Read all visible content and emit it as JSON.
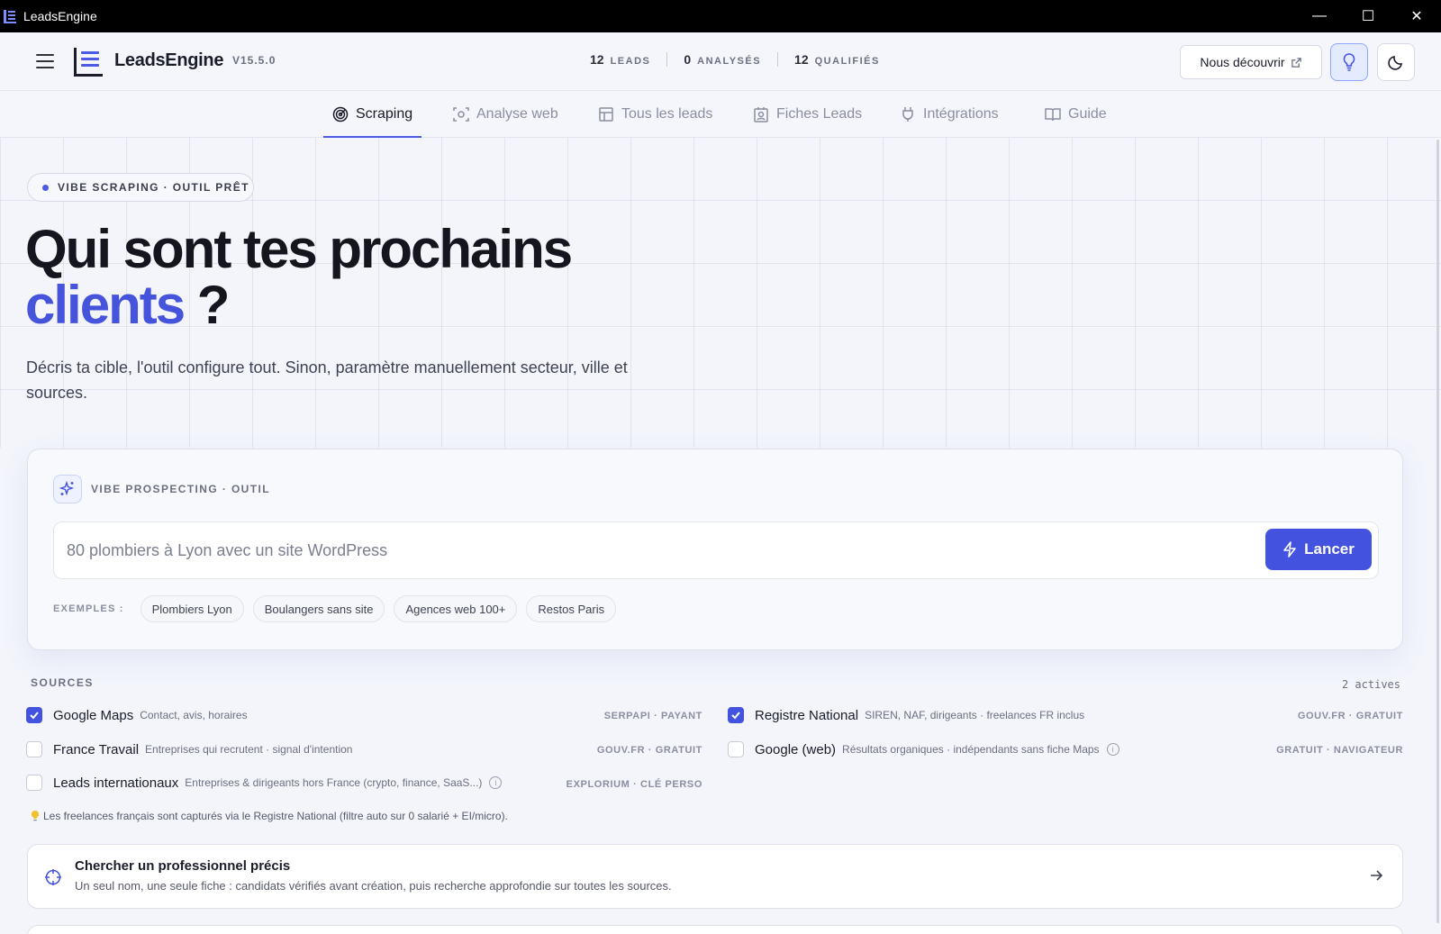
{
  "window": {
    "title": "LeadsEngine",
    "controls": {
      "minimize": "—",
      "maximize": "☐",
      "close": "✕"
    }
  },
  "header": {
    "brand": "LeadsEngine",
    "version": "V15.5.0",
    "stats": [
      {
        "num": "12",
        "label": "LEADS"
      },
      {
        "num": "0",
        "label": "ANALYSÉS"
      },
      {
        "num": "12",
        "label": "QUALIFIÉS"
      }
    ],
    "discover_label": "Nous découvrir"
  },
  "tabs": [
    {
      "label": "Scraping",
      "icon": "radar-icon",
      "active": true
    },
    {
      "label": "Analyse web",
      "icon": "scan-icon"
    },
    {
      "label": "Tous les leads",
      "icon": "table-icon"
    },
    {
      "label": "Fiches Leads",
      "icon": "contact-card-icon"
    },
    {
      "label": "Intégrations",
      "icon": "plug-icon"
    },
    {
      "label": "Guide",
      "icon": "book-icon"
    }
  ],
  "hero": {
    "status": "VIBE SCRAPING · OUTIL PRÊT",
    "title_line1": "Qui sont tes prochains",
    "title_accent": "clients",
    "title_end": " ?",
    "subtitle": "Décris ta cible, l'outil configure tout. Sinon, paramètre manuellement secteur, ville et sources."
  },
  "vibe": {
    "label": "VIBE PROSPECTING · OUTIL",
    "input_value": "80 plombiers à Lyon avec un site WordPress",
    "launch_label": "Lancer",
    "examples_label": "EXEMPLES :",
    "examples": [
      "Plombiers Lyon",
      "Boulangers sans site",
      "Agences web 100+",
      "Restos Paris"
    ]
  },
  "sources": {
    "title": "SOURCES",
    "count": "2 actives",
    "items": [
      {
        "name": "Google Maps",
        "desc": "Contact, avis, horaires",
        "tag": "SERPAPI · PAYANT",
        "checked": true
      },
      {
        "name": "Registre National",
        "desc": "SIREN, NAF, dirigeants · freelances FR inclus",
        "tag": "GOUV.FR · GRATUIT",
        "checked": true
      },
      {
        "name": "France Travail",
        "desc": "Entreprises qui recrutent · signal d'intention",
        "tag": "GOUV.FR · GRATUIT",
        "checked": false
      },
      {
        "name": "Google (web)",
        "desc": "Résultats organiques · indépendants sans fiche Maps",
        "tag": "GRATUIT · NAVIGATEUR",
        "checked": false
      },
      {
        "name": "Leads internationaux",
        "desc": "Entreprises & dirigeants hors France (crypto, finance, SaaS...)",
        "tag": "EXPLORIUM · CLÉ PERSO",
        "checked": false
      }
    ],
    "note": "Les freelances français sont capturés via le Registre National (filtre auto sur 0 salarié + EI/micro)."
  },
  "pro_search": {
    "title": "Chercher un professionnel précis",
    "desc": "Un seul nom, une seule fiche : candidats vérifiés avant création, puis recherche approfondie sur toutes les sources."
  },
  "colors": {
    "accent": "#4452e0",
    "accent_text": "#4654dc",
    "titlebar": "#000000"
  }
}
